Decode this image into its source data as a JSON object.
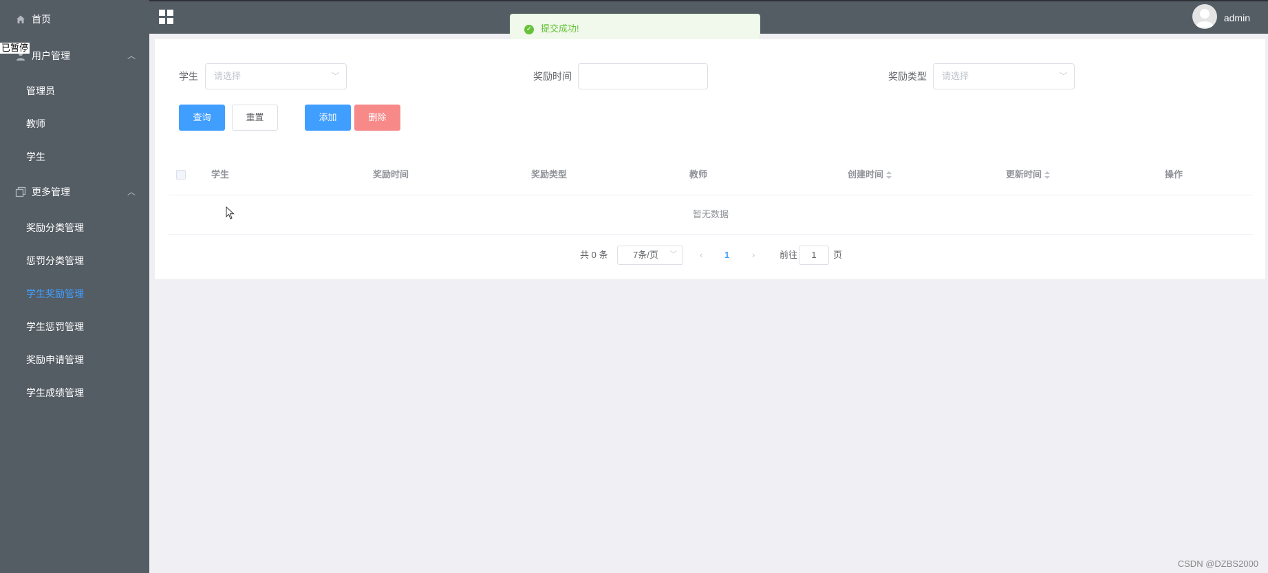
{
  "overlay": {
    "pause_note": "已暂停"
  },
  "sidebar": {
    "home": "首页",
    "user_mgmt": {
      "label": "用户管理",
      "items": [
        "管理员",
        "教师",
        "学生"
      ]
    },
    "more_mgmt": {
      "label": "更多管理",
      "items": [
        "奖励分类管理",
        "惩罚分类管理",
        "学生奖励管理",
        "学生惩罚管理",
        "奖励申请管理",
        "学生成绩管理"
      ],
      "active": "学生奖励管理"
    }
  },
  "header": {
    "username": "admin"
  },
  "toast": {
    "message": "提交成功!"
  },
  "filters": {
    "student_label": "学生",
    "student_placeholder": "请选择",
    "time_label": "奖励时间",
    "time_value": "",
    "type_label": "奖励类型",
    "type_placeholder": "请选择"
  },
  "buttons": {
    "query": "查询",
    "reset": "重置",
    "add": "添加",
    "delete": "删除"
  },
  "table": {
    "columns": [
      "学生",
      "奖励时间",
      "奖励类型",
      "教师",
      "创建时间",
      "更新时间",
      "操作"
    ],
    "empty_text": "暂无数据"
  },
  "pagination": {
    "total": "共 0 条",
    "page_size": "7条/页",
    "current": "1",
    "goto_label": "前往",
    "goto_value": "1",
    "page_unit": "页"
  },
  "watermark": "CSDN @DZBS2000",
  "colors": {
    "sidebar": "#545c64",
    "primary": "#409eff",
    "danger": "#f78989",
    "success": "#67c23a"
  }
}
